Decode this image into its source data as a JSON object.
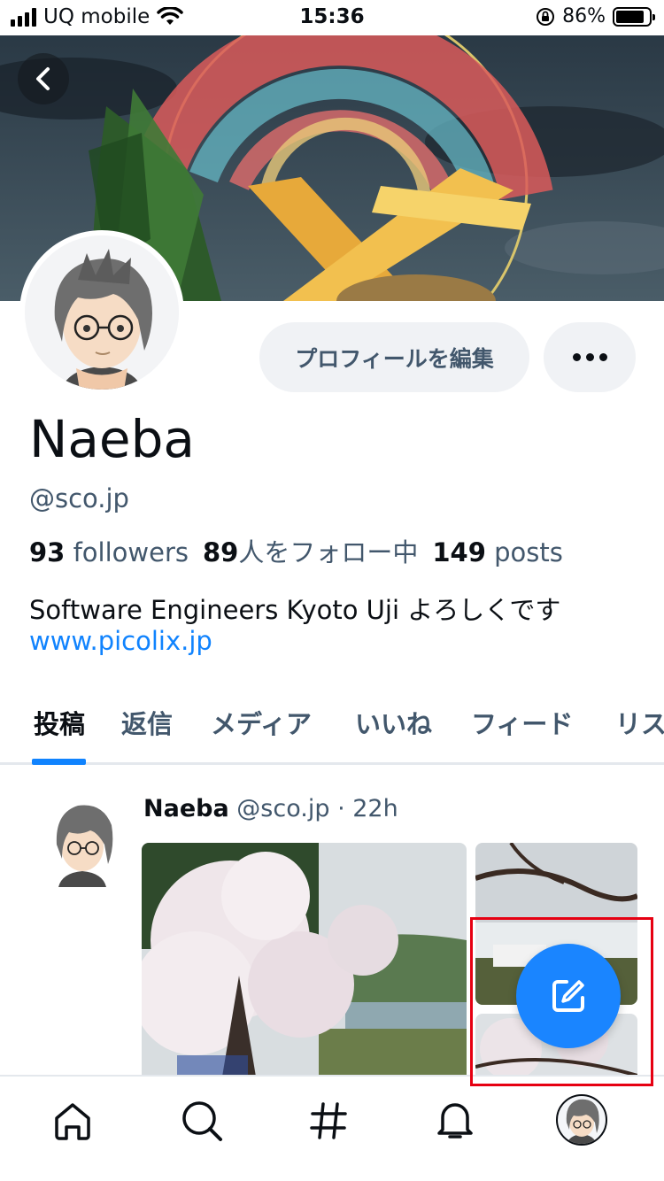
{
  "status_bar": {
    "carrier": "UQ mobile",
    "time": "15:36",
    "battery_percent": "86%",
    "battery_level": 0.86
  },
  "profile": {
    "display_name": "Naeba",
    "handle": "@sco.jp",
    "edit_button_label": "プロフィールを編集",
    "followers_count": "93",
    "followers_label": "followers",
    "following_count": "89",
    "following_label": "人をフォロー中",
    "posts_count": "149",
    "posts_label": "posts",
    "bio": "Software Engineers Kyoto Uji よろしくです",
    "website": "www.picolix.jp"
  },
  "tabs": [
    {
      "label": "投稿",
      "active": true
    },
    {
      "label": "返信",
      "active": false
    },
    {
      "label": "メディア",
      "active": false
    },
    {
      "label": "いいね",
      "active": false
    },
    {
      "label": "フィード",
      "active": false
    },
    {
      "label": "リスト",
      "active": false
    }
  ],
  "post": {
    "author_name": "Naeba",
    "author_handle": "@sco.jp",
    "separator": "·",
    "time_ago": "22h"
  },
  "icons": {
    "back": "chevron-left-icon",
    "more": "ellipsis-icon",
    "compose": "compose-icon",
    "home": "home-icon",
    "search": "search-icon",
    "feeds": "hashtag-icon",
    "notifications": "bell-icon",
    "profile": "avatar"
  },
  "colors": {
    "accent": "#1083fe",
    "fab": "#1a85ff",
    "muted_text": "#42576c",
    "highlight_box": "#e60012"
  }
}
